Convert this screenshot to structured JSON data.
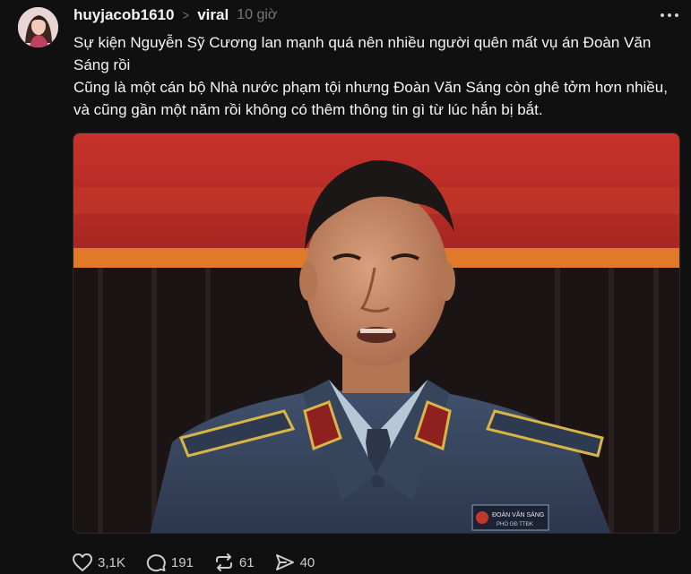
{
  "post": {
    "author": "huyjacob1610",
    "community": "viral",
    "time": "10 giờ",
    "text_paragraphs": [
      "Sự kiện Nguyễn Sỹ Cương lan mạnh quá nên nhiều người quên mất vụ án Đoàn Văn Sáng rồi",
      "Cũng là một cán bộ Nhà nước phạm tội nhưng Đoàn Văn Sáng còn ghê tởm hơn nhiều, và cũng gần một năm rồi không có thêm thông tin gì từ lúc hắn bị bắt."
    ],
    "badge_name": "ĐOÀN VĂN SÁNG",
    "badge_title": "PHÓ GĐ TTĐK",
    "icons": {
      "more": "more-horizontal-icon",
      "chevron": "chevron-right-icon",
      "like": "heart-icon",
      "reply": "comment-bubble-icon",
      "repost": "repost-icon",
      "share": "send-icon"
    }
  },
  "stats": {
    "likes": "3,1K",
    "replies": "191",
    "reposts": "61",
    "shares": "40"
  },
  "colors": {
    "background": "#101010",
    "text": "#f3f5f7",
    "muted": "#777777",
    "action": "#cccccc"
  }
}
